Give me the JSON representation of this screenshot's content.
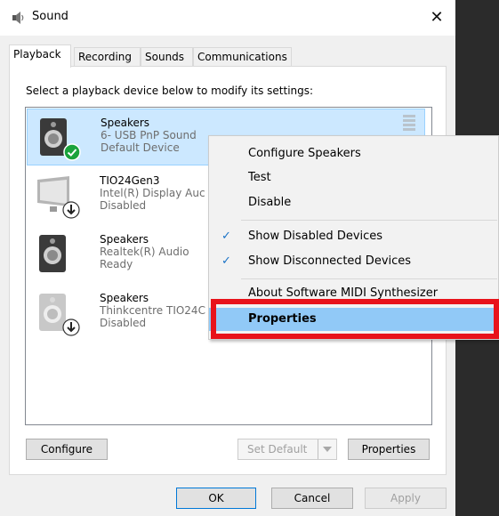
{
  "window": {
    "title": "Sound",
    "close_glyph": "✕"
  },
  "tabs": [
    {
      "label": "Playback"
    },
    {
      "label": "Recording"
    },
    {
      "label": "Sounds"
    },
    {
      "label": "Communications"
    }
  ],
  "instruction": "Select a playback device below to modify its settings:",
  "devices": [
    {
      "name": "Speakers",
      "detail": "6- USB PnP Sound",
      "status": "Default Device",
      "icon": "speaker-icon",
      "badge": "default-check-icon"
    },
    {
      "name": "TIO24Gen3",
      "detail": "Intel(R) Display Auc",
      "status": "Disabled",
      "icon": "monitor-icon",
      "badge": "disabled-arrow-icon"
    },
    {
      "name": "Speakers",
      "detail": "Realtek(R) Audio",
      "status": "Ready",
      "icon": "speaker-icon",
      "badge": ""
    },
    {
      "name": "Speakers",
      "detail": "Thinkcentre TIO24C",
      "status": "Disabled",
      "icon": "speaker-icon",
      "badge": "disabled-arrow-icon"
    }
  ],
  "context_menu": {
    "items": [
      {
        "label": "Configure Speakers",
        "checked": false
      },
      {
        "label": "Test",
        "checked": false
      },
      {
        "label": "Disable",
        "checked": false
      },
      {
        "label": "Show Disabled Devices",
        "checked": true
      },
      {
        "label": "Show Disconnected Devices",
        "checked": true
      },
      {
        "label": "About Software MIDI Synthesizer",
        "checked": false
      },
      {
        "label": "Properties",
        "checked": false,
        "highlighted": true
      }
    ],
    "check_glyph": "✓"
  },
  "buttons": {
    "configure": "Configure",
    "set_default": "Set Default",
    "properties": "Properties",
    "ok": "OK",
    "cancel": "Cancel",
    "apply": "Apply"
  },
  "colors": {
    "selection": "#cce8ff",
    "menu_highlight": "#91c9f7",
    "annotation_red": "#e8131b",
    "check_green": "#1aa33c"
  }
}
